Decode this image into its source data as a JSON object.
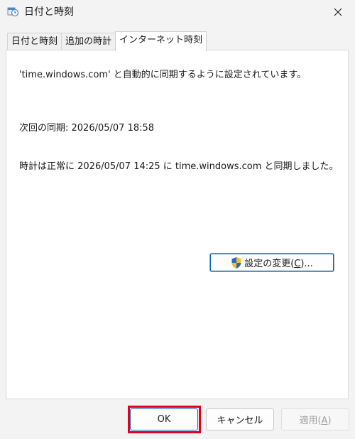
{
  "window": {
    "title": "日付と時刻"
  },
  "tabs": [
    {
      "label": "日付と時刻",
      "active": false
    },
    {
      "label": "追加の時計",
      "active": false
    },
    {
      "label": "インターネット時刻",
      "active": true
    }
  ],
  "panel": {
    "sync_message": "'time.windows.com' と自動的に同期するように設定されています。",
    "next_sync": "次回の同期: 2026/05/07 18:58",
    "last_sync": "時計は正常に 2026/05/07 14:25 に time.windows.com と同期しました。",
    "change_settings": {
      "label_before": "設定の変更(",
      "accel": "C",
      "label_after": ")..."
    }
  },
  "buttons": {
    "ok": "OK",
    "cancel": "キャンセル",
    "apply": {
      "label_before": "適用(",
      "accel": "A",
      "label_after": ")",
      "enabled": false
    }
  },
  "colors": {
    "accent": "#0067c0",
    "highlight": "#e3001b",
    "disabled_text": "#a0a0a0"
  }
}
